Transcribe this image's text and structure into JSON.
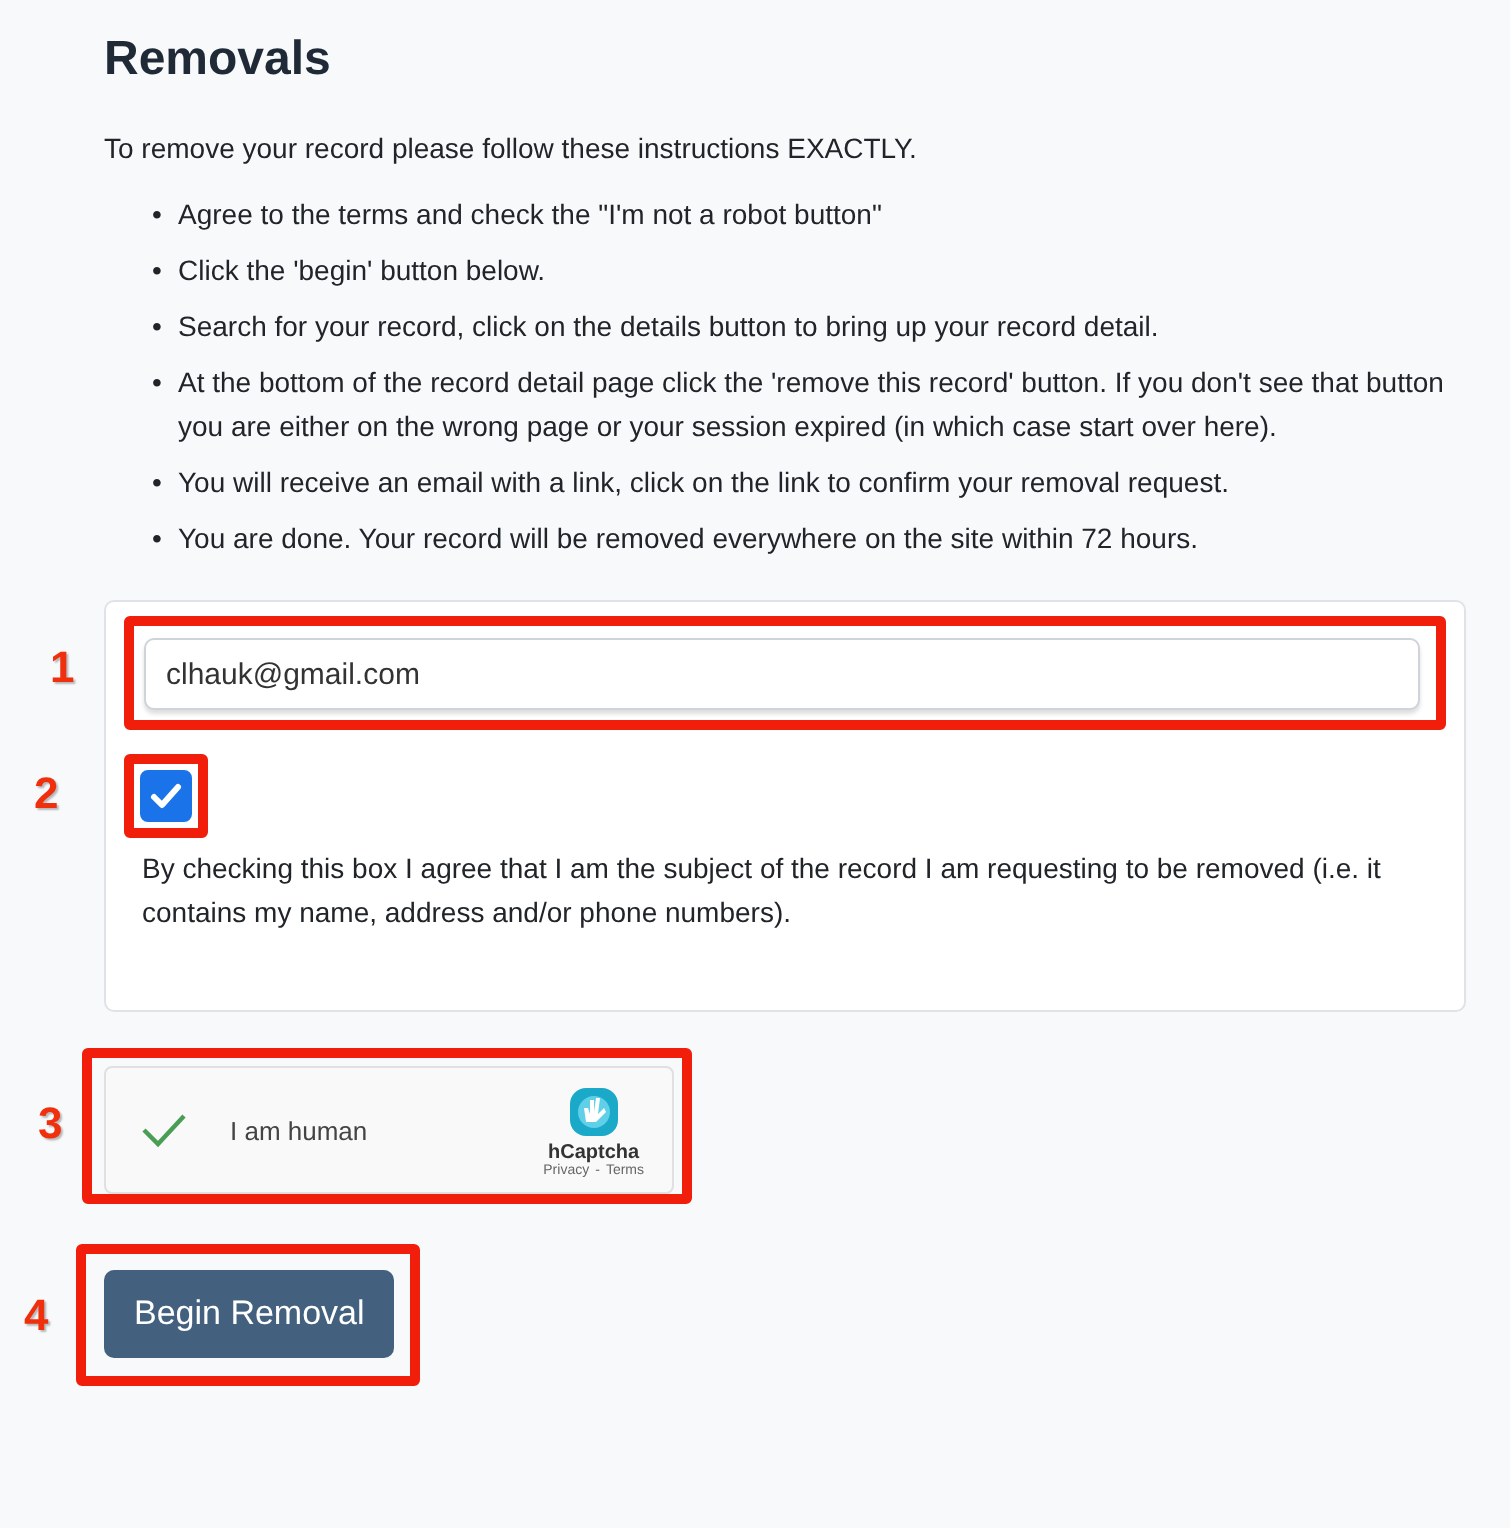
{
  "title": "Removals",
  "intro": "To remove your record please follow these instructions EXACTLY.",
  "bullet": "•",
  "steps": [
    "Agree to the terms and check the \"I'm not a robot button\"",
    "Click the 'begin' button below.",
    "Search for your record, click on the details button to bring up your record detail.",
    "At the bottom of the record detail page click the 'remove this record' button. If you don't see that button you are either on the wrong page or your session expired (in which case start over here).",
    "You will receive an email with a link, click on the link to confirm your removal request.",
    "You are done. Your record will be removed everywhere on the site within 72 hours."
  ],
  "form": {
    "email": {
      "value": "clhauk@gmail.com",
      "annotation": "1"
    },
    "agree": {
      "checked": true,
      "annotation": "2",
      "label": "By checking this box I agree that I am the subject of the record I am requesting to be removed (i.e. it contains my name, address and/or phone numbers)."
    }
  },
  "captcha": {
    "checked": true,
    "label": "I am human",
    "brand": "hCaptcha",
    "links": [
      "Privacy",
      "Terms"
    ],
    "separator": "-",
    "annotation": "3"
  },
  "button": {
    "label": "Begin Removal",
    "annotation": "4"
  }
}
